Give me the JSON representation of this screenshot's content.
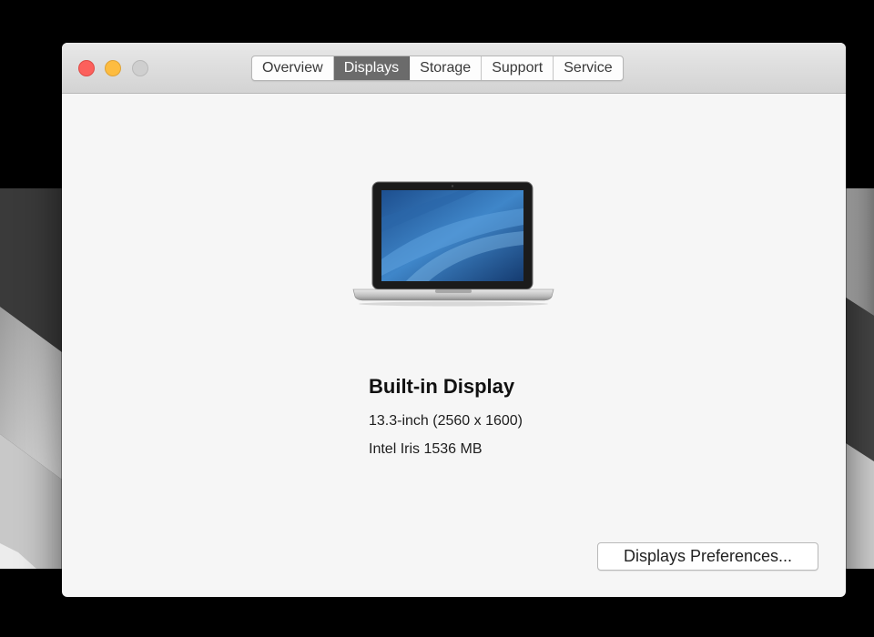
{
  "window": {
    "tabs": [
      {
        "label": "Overview",
        "active": false
      },
      {
        "label": "Displays",
        "active": true
      },
      {
        "label": "Storage",
        "active": false
      },
      {
        "label": "Support",
        "active": false
      },
      {
        "label": "Service",
        "active": false
      }
    ]
  },
  "display": {
    "title": "Built-in Display",
    "size_resolution": "13.3-inch (2560 x 1600)",
    "graphics": "Intel Iris 1536 MB"
  },
  "buttons": {
    "preferences_label": "Displays Preferences..."
  },
  "colors": {
    "close": "#fc605c",
    "minimize": "#fdbc40",
    "zoom_disabled": "#cfcfcf",
    "active_tab": "#6b6b6b"
  },
  "icons": {
    "hero": "macbook-pro-icon"
  }
}
